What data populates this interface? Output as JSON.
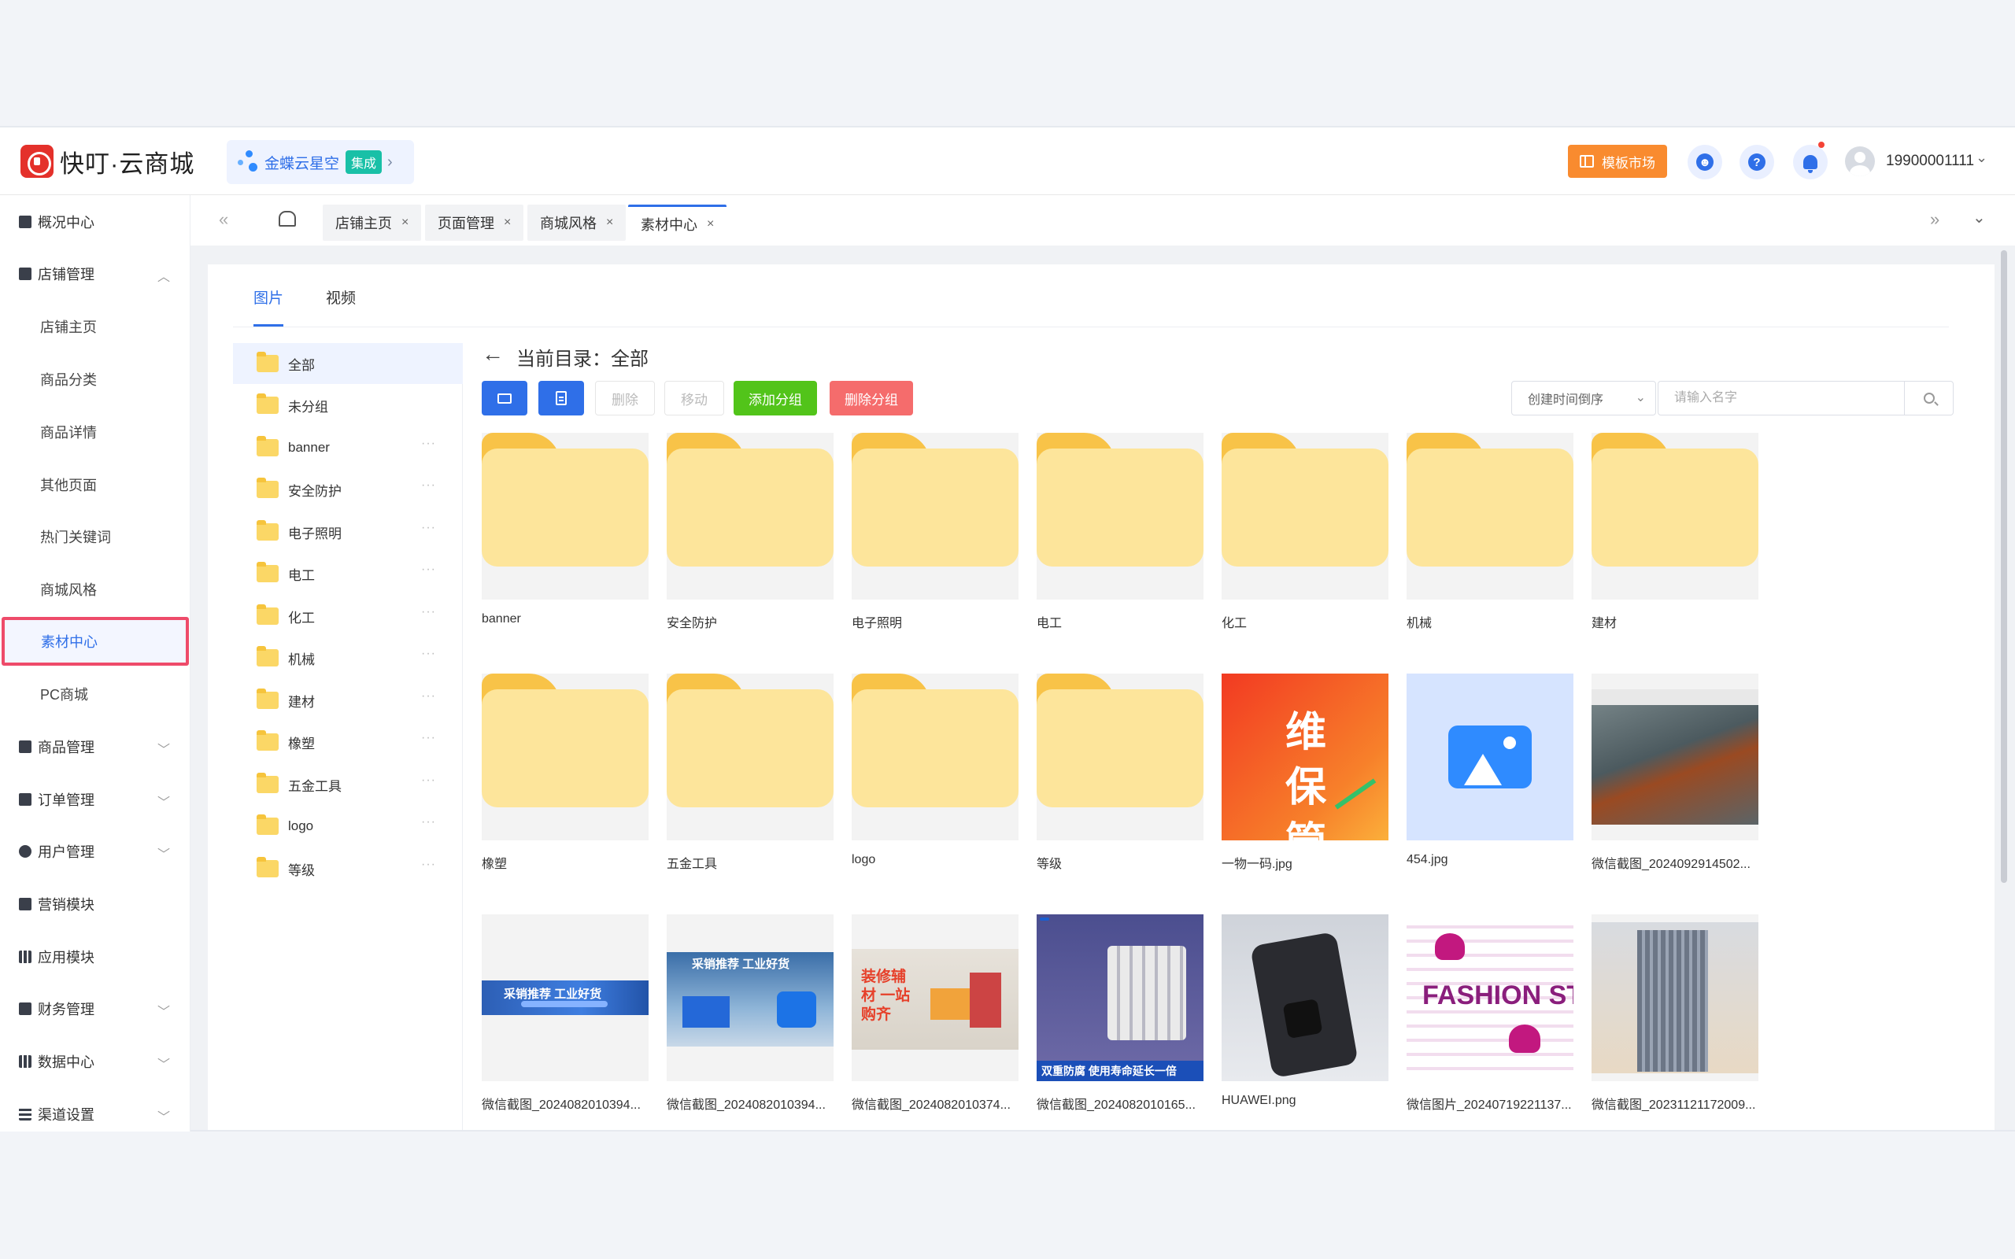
{
  "header": {
    "app_name": "快叮·云商城",
    "integration_label": "金蝶云星空",
    "integration_badge": "集成",
    "template_market_label": "模板市场",
    "user_name": "19900001111"
  },
  "sidebar": {
    "items": [
      {
        "label": "概况中心"
      },
      {
        "label": "店铺管理"
      },
      {
        "label": "店铺主页"
      },
      {
        "label": "商品分类"
      },
      {
        "label": "商品详情"
      },
      {
        "label": "其他页面"
      },
      {
        "label": "热门关键词"
      },
      {
        "label": "商城风格"
      },
      {
        "label": "素材中心"
      },
      {
        "label": "PC商城"
      },
      {
        "label": "商品管理"
      },
      {
        "label": "订单管理"
      },
      {
        "label": "用户管理"
      },
      {
        "label": "营销模块"
      },
      {
        "label": "应用模块"
      },
      {
        "label": "财务管理"
      },
      {
        "label": "数据中心"
      },
      {
        "label": "渠道设置"
      }
    ]
  },
  "tabs": [
    {
      "label": "店铺主页"
    },
    {
      "label": "页面管理"
    },
    {
      "label": "商城风格"
    },
    {
      "label": "素材中心"
    }
  ],
  "media_tabs": {
    "images": "图片",
    "videos": "视频"
  },
  "groups": [
    {
      "label": "全部"
    },
    {
      "label": "未分组"
    },
    {
      "label": "banner"
    },
    {
      "label": "安全防护"
    },
    {
      "label": "电子照明"
    },
    {
      "label": "电工"
    },
    {
      "label": "化工"
    },
    {
      "label": "机械"
    },
    {
      "label": "建材"
    },
    {
      "label": "橡塑"
    },
    {
      "label": "五金工具"
    },
    {
      "label": "logo"
    },
    {
      "label": "等级"
    }
  ],
  "toolbar": {
    "current_dir": "当前目录：全部",
    "delete_label": "删除",
    "move_label": "移动",
    "add_group_label": "添加分组",
    "delete_group_label": "删除分组",
    "sort_label": "创建时间倒序",
    "search_placeholder": "请输入名字"
  },
  "files": [
    {
      "name": "banner",
      "type": "folder"
    },
    {
      "name": "安全防护",
      "type": "folder"
    },
    {
      "name": "电子照明",
      "type": "folder"
    },
    {
      "name": "电工",
      "type": "folder"
    },
    {
      "name": "化工",
      "type": "folder"
    },
    {
      "name": "机械",
      "type": "folder"
    },
    {
      "name": "建材",
      "type": "folder"
    },
    {
      "name": "橡塑",
      "type": "folder"
    },
    {
      "name": "五金工具",
      "type": "folder"
    },
    {
      "name": "logo",
      "type": "folder"
    },
    {
      "name": "等级",
      "type": "folder"
    },
    {
      "name": "一物一码.jpg",
      "type": "image",
      "image_text": "维保管家"
    },
    {
      "name": "454.jpg",
      "type": "image"
    },
    {
      "name": "微信截图_2024092914502...",
      "type": "image"
    },
    {
      "name": "微信截图_2024082010394...",
      "type": "image",
      "image_text": "采销推荐 工业好货"
    },
    {
      "name": "微信截图_2024082010394...",
      "type": "image",
      "image_text": "采销推荐 工业好货"
    },
    {
      "name": "微信截图_2024082010374...",
      "type": "image",
      "image_text": "装修辅材 一站购齐"
    },
    {
      "name": "微信截图_2024082010165...",
      "type": "image",
      "image_text": "双重防腐 使用寿命延长一倍"
    },
    {
      "name": "HUAWEI.png",
      "type": "image"
    },
    {
      "name": "微信图片_20240719221137...",
      "type": "image",
      "image_text": "FASHION STYLE"
    },
    {
      "name": "微信截图_20231121172009...",
      "type": "image"
    }
  ],
  "colors": {
    "primary": "#2f6fe8",
    "add_group": "#52c41a",
    "delete_group": "#f56c6c",
    "template_market": "#f98b2f",
    "active_highlight": "#ee4b6a"
  }
}
